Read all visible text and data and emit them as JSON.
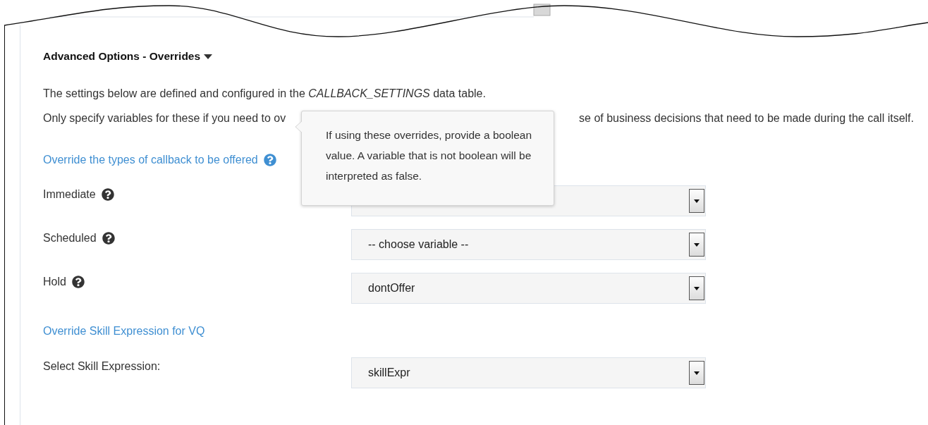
{
  "heading": {
    "title": "Advanced Options - Overrides",
    "expanded": true
  },
  "intro": "The settings below are defined and configured in the *CALLBACK_SETTINGS* data table.",
  "note": {
    "start": "Only specify variables for these if you need to ov",
    "end": "se of business decisions that need to be made during the call itself."
  },
  "tooltip": {
    "text": "If using these overrides, provide a boolean value. A variable that is not boolean will be interpreted as false."
  },
  "sections": [
    {
      "title": "Override the types of callback to be offered",
      "help": true,
      "fields": [
        {
          "label": "Immediate",
          "help": true
        },
        {
          "label": "Scheduled",
          "help": true,
          "value": "-- choose variable --"
        },
        {
          "label": "Hold",
          "help": true,
          "value": "dontOffer"
        }
      ]
    },
    {
      "title": "Override Skill Expression for VQ",
      "help": false,
      "fields": [
        {
          "label": "Select Skill Expression:",
          "help": false,
          "value": "skillExpr"
        }
      ]
    }
  ]
}
